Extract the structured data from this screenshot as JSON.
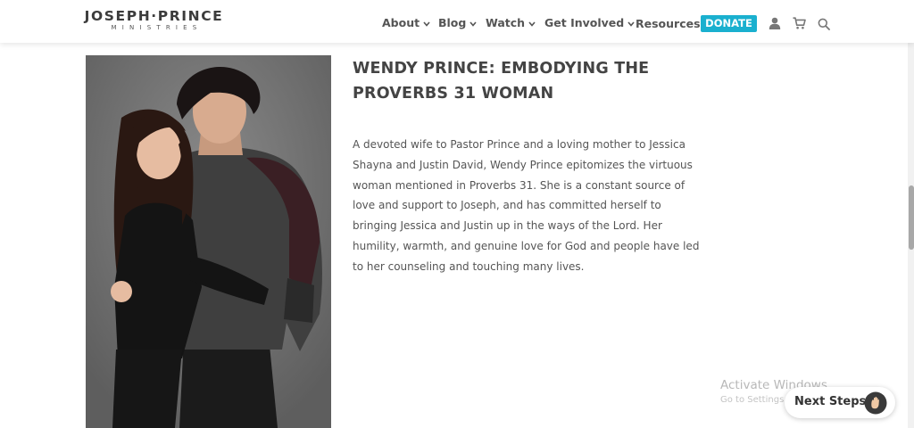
{
  "header": {
    "logo_main": "JOSEPH·PRINCE",
    "logo_sub": "MINISTRIES",
    "nav": [
      {
        "label": "About",
        "dropdown": true
      },
      {
        "label": "Blog",
        "dropdown": true
      },
      {
        "label": "Watch",
        "dropdown": true
      },
      {
        "label": "Get Involved",
        "dropdown": true
      },
      {
        "label": "Resources",
        "dropdown": false
      }
    ],
    "donate_label": "DONATE",
    "icons": [
      "user-icon",
      "cart-icon",
      "search-icon"
    ],
    "accent_color": "#1ab0cf"
  },
  "article": {
    "title": "WENDY PRINCE: EMBODYING THE PROVERBS 31 WOMAN",
    "body": "A devoted wife to Pastor Prince and a loving mother to Jessica Shayna and Justin David, Wendy Prince epitomizes the virtuous woman mentioned in Proverbs 31. She is a constant source of love and support to Joseph, and has committed herself to bringing Jessica and Justin up in the ways of the Lord. Her humility, warmth, and genuine love for God and people have led to her counseling and touching many lives."
  },
  "overlay": {
    "activate_title": "Activate Windows",
    "activate_sub": "Go to Settings to activate Windows.",
    "next_steps_label": "Next Steps"
  }
}
